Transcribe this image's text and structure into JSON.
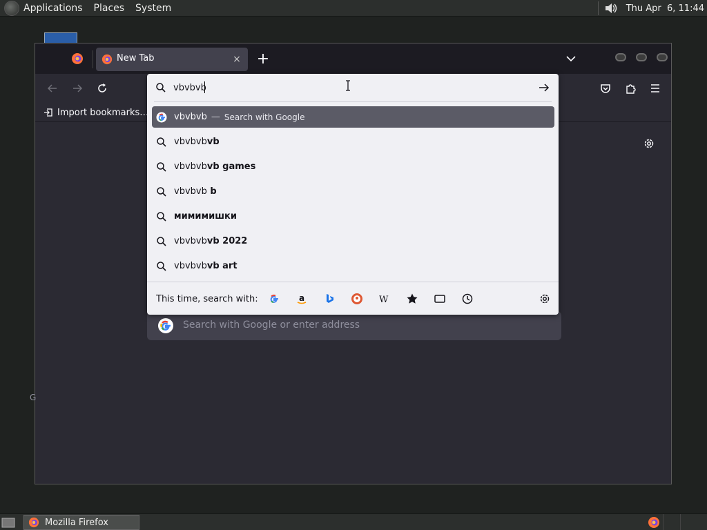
{
  "top_panel": {
    "menus": [
      "Applications",
      "Places",
      "System"
    ],
    "clock": "Thu Apr  6, 11:44"
  },
  "browser": {
    "tab": {
      "title": "New Tab",
      "close": "×"
    },
    "new_tab_label": "+",
    "bookmarks": {
      "import_label": "Import bookmarks…"
    },
    "page": {
      "search_placeholder": "Search with Google or enter address",
      "left_letter": "G"
    },
    "colors": {
      "chrome_dark": "#1c1b22",
      "toolbar": "#2b2a33",
      "popup": "#f0f0f4",
      "selected_row": "#5b5b66"
    }
  },
  "urlbar": {
    "value": "vbvbvb",
    "results": [
      {
        "icon": "google-icon",
        "prefix": "vbvbvb",
        "bold": "",
        "action": "Search with Google",
        "selected": true
      },
      {
        "icon": "search-icon",
        "prefix": "vbvbvb",
        "bold": "vb",
        "action": "",
        "selected": false
      },
      {
        "icon": "search-icon",
        "prefix": "vbvbvb",
        "bold": "vb games",
        "action": "",
        "selected": false
      },
      {
        "icon": "search-icon",
        "prefix": "vbvbvb",
        "bold": " b",
        "action": "",
        "selected": false
      },
      {
        "icon": "search-icon",
        "prefix": "",
        "bold": "мимимишки",
        "action": "",
        "selected": false
      },
      {
        "icon": "search-icon",
        "prefix": "vbvbvb",
        "bold": "vb 2022",
        "action": "",
        "selected": false
      },
      {
        "icon": "search-icon",
        "prefix": "vbvbvb",
        "bold": "vb art",
        "action": "",
        "selected": false
      }
    ],
    "separator": "—",
    "footer": {
      "label": "This time, search with:",
      "engines": [
        "google-icon",
        "amazon-icon",
        "bing-icon",
        "duckduckgo-icon",
        "wikipedia-icon",
        "bookmarks-star-icon",
        "tabs-icon",
        "history-clock-icon"
      ]
    }
  },
  "taskbar": {
    "window_label": "Mozilla Firefox"
  }
}
